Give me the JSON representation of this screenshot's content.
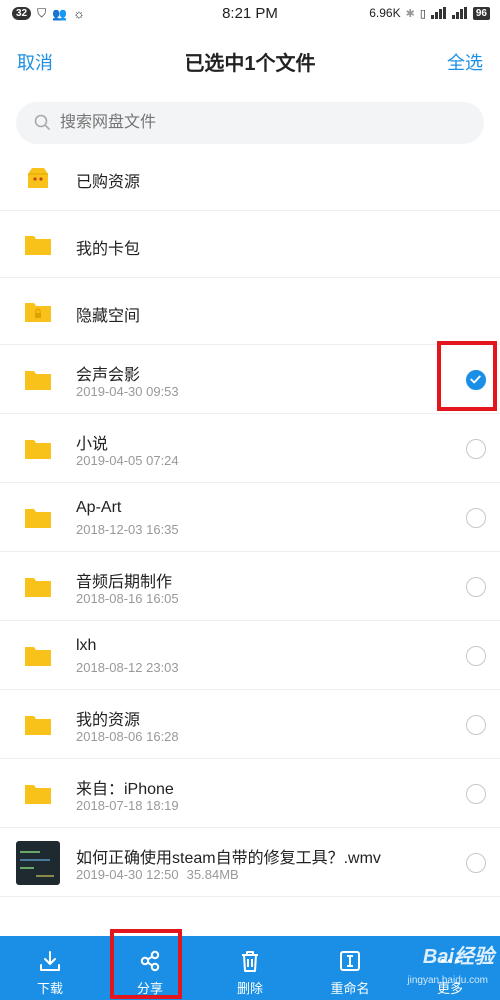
{
  "status_bar": {
    "notif_count": "32",
    "time": "8:21 PM",
    "speed": "6.96K",
    "battery": "96"
  },
  "header": {
    "cancel_label": "取消",
    "title": "已选中1个文件",
    "select_all_label": "全选"
  },
  "search": {
    "placeholder": "搜索网盘文件"
  },
  "items": [
    {
      "name": "已购资源",
      "kind": "purchased"
    },
    {
      "name": "我的卡包",
      "kind": "folder"
    },
    {
      "name": "隐藏空间",
      "kind": "locked-folder"
    },
    {
      "name": "会声会影",
      "date": "2019-04-30  09:53",
      "checked": true
    },
    {
      "name": "小说",
      "date": "2019-04-05  07:24",
      "checked": false
    },
    {
      "name": "Ap-Art",
      "date": "2018-12-03  16:35",
      "checked": false
    },
    {
      "name": "音频后期制作",
      "date": "2018-08-16  16:05",
      "checked": false
    },
    {
      "name": "lxh",
      "date": "2018-08-12  23:03",
      "checked": false
    },
    {
      "name": "我的资源",
      "date": "2018-08-06  16:28",
      "checked": false
    },
    {
      "name": "来自：iPhone",
      "date": "2018-07-18  18:19",
      "checked": false
    },
    {
      "name": "如何正确使用steam自带的修复工具？.wmv",
      "date": "2019-04-30  12:50",
      "size": "35.84MB",
      "checked": false,
      "kind": "video"
    }
  ],
  "bottom_bar": {
    "download": "下载",
    "share": "分享",
    "delete": "删除",
    "rename": "重命名",
    "more": "更多"
  },
  "watermark": {
    "brand": "Bai经验",
    "site": "jingyan.baidu.com"
  },
  "colors": {
    "accent": "#1b8fe6",
    "folder": "#f9c21a",
    "highlight": "#e3161d"
  }
}
